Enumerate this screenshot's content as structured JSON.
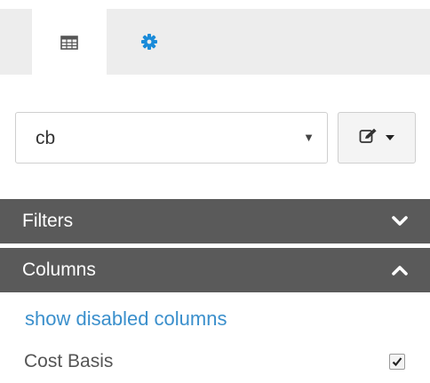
{
  "tabs": [
    {
      "icon": "table-icon",
      "active": true
    },
    {
      "icon": "gear-icon",
      "active": false
    }
  ],
  "colors": {
    "accent": "#1a8bd9",
    "header_bg": "#5a5a5a",
    "link": "#3a8fcc",
    "tab_strip": "#ededed"
  },
  "selector": {
    "value": "cb",
    "arrow": "▼"
  },
  "edit_button": {
    "icon": "edit-icon"
  },
  "sections": {
    "filters": {
      "label": "Filters",
      "expanded": false
    },
    "columns": {
      "label": "Columns",
      "expanded": true
    }
  },
  "columns_panel": {
    "show_disabled_link": "show disabled columns",
    "items": [
      {
        "label": "Cost Basis",
        "checked": true
      }
    ]
  }
}
